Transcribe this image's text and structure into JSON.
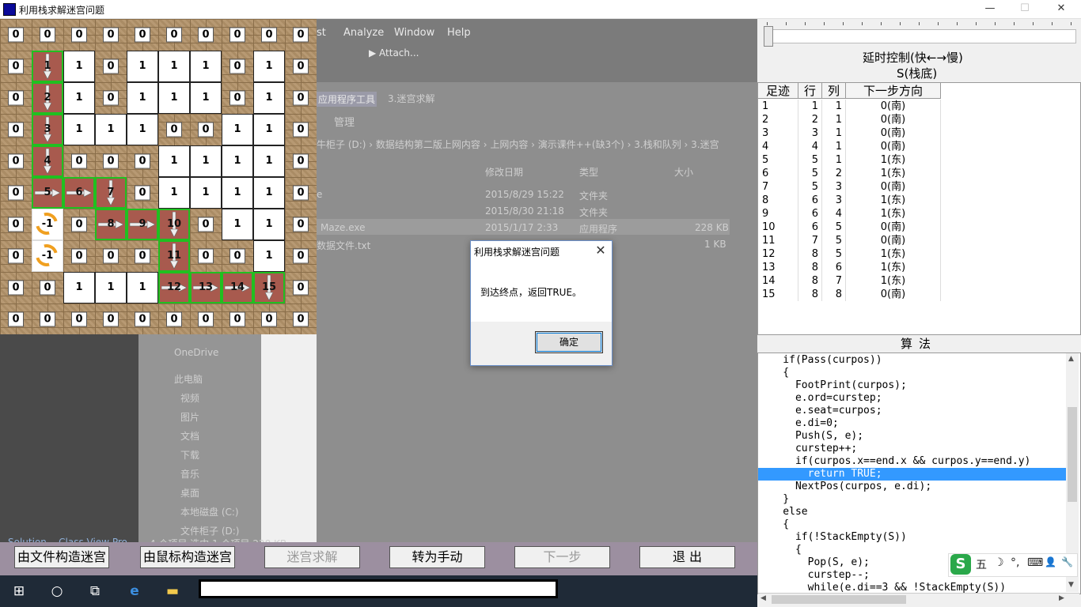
{
  "window": {
    "title": "利用栈求解迷宫问题",
    "min": "—",
    "max": "☐",
    "close": "✕"
  },
  "maze": {
    "grid": [
      [
        "0",
        "0",
        "0",
        "0",
        "0",
        "0",
        "0",
        "0",
        "0",
        "0"
      ],
      [
        "0",
        "S",
        "1",
        "0",
        "1",
        "1",
        "1",
        "0",
        "1",
        "0"
      ],
      [
        "0",
        "S",
        "1",
        "0",
        "1",
        "1",
        "1",
        "0",
        "1",
        "0"
      ],
      [
        "0",
        "S",
        "1",
        "1",
        "1",
        "0",
        "0",
        "1",
        "1",
        "0"
      ],
      [
        "0",
        "S",
        "0",
        "0",
        "0",
        "1",
        "1",
        "1",
        "1",
        "0"
      ],
      [
        "0",
        "E",
        "E",
        "S",
        "0",
        "1",
        "1",
        "1",
        "1",
        "0"
      ],
      [
        "0",
        "X",
        "0",
        "E",
        "E",
        "S",
        "0",
        "1",
        "1",
        "0"
      ],
      [
        "0",
        "X",
        "0",
        "0",
        "0",
        "S",
        "0",
        "0",
        "1",
        "0"
      ],
      [
        "0",
        "0",
        "1",
        "1",
        "1",
        "E",
        "E",
        "E",
        "S",
        "0"
      ],
      [
        "0",
        "0",
        "0",
        "0",
        "0",
        "0",
        "0",
        "0",
        "0",
        "0"
      ]
    ],
    "path_labels": {
      "1-1": "1",
      "2-1": "2",
      "3-1": "3",
      "4-1": "4",
      "5-1": "5",
      "5-2": "6",
      "5-3": "7",
      "6-3": "8",
      "6-4": "9",
      "6-5": "10",
      "7-5": "11",
      "8-5": "12",
      "8-6": "13",
      "8-7": "14",
      "8-8": "15"
    },
    "dead_label": "-1"
  },
  "background": {
    "menu": [
      "st",
      "Analyze",
      "Window",
      "Help"
    ],
    "attach": "▶ Attach...",
    "ribbon_tool": "应用程序工具",
    "ribbon_tab": "3.迷宫求解",
    "manage": "管理",
    "breadcrumb": "牛柜子 (D:)  ›  数据结构第二版上网内容  ›  上网内容  ›  演示课件++(缺3个)  ›  3.栈和队列  ›  3.迷宫",
    "col_date": "修改日期",
    "col_type": "类型",
    "col_size": "大小",
    "files": [
      {
        "name": "e",
        "date": "2015/8/29 15:22",
        "type": "文件夹",
        "size": ""
      },
      {
        "name": "",
        "date": "2015/8/30 21:18",
        "type": "文件夹",
        "size": ""
      },
      {
        "name": "Maze.exe",
        "date": "2015/1/17 2:33",
        "type": "应用程序",
        "size": "228 KB"
      },
      {
        "name": "数据文件.txt",
        "date": "",
        "type": "",
        "size": "1 KB"
      }
    ],
    "nav": [
      "OneDrive",
      "此电脑",
      "视频",
      "图片",
      "文档",
      "下载",
      "音乐",
      "桌面",
      "本地磁盘 (C:)",
      "文件柜子 (D:)"
    ],
    "status": "4 个项目    选中 1 个项目  228 KB",
    "vs_tabs": "Solution...   Class View   Pro"
  },
  "dialog": {
    "title": "利用栈求解迷宫问题",
    "message": "到达终点，返回TRUE。",
    "ok": "确定"
  },
  "right": {
    "delay_label": "延时控制(快←→慢)",
    "stack_title": "S(栈底)",
    "headers": [
      "足迹",
      "行",
      "列",
      "下一步方向"
    ],
    "rows": [
      [
        "1",
        "1",
        "1",
        "0(南)"
      ],
      [
        "2",
        "2",
        "1",
        "0(南)"
      ],
      [
        "3",
        "3",
        "1",
        "0(南)"
      ],
      [
        "4",
        "4",
        "1",
        "0(南)"
      ],
      [
        "5",
        "5",
        "1",
        "1(东)"
      ],
      [
        "6",
        "5",
        "2",
        "1(东)"
      ],
      [
        "7",
        "5",
        "3",
        "0(南)"
      ],
      [
        "8",
        "6",
        "3",
        "1(东)"
      ],
      [
        "9",
        "6",
        "4",
        "1(东)"
      ],
      [
        "10",
        "6",
        "5",
        "0(南)"
      ],
      [
        "11",
        "7",
        "5",
        "0(南)"
      ],
      [
        "12",
        "8",
        "5",
        "1(东)"
      ],
      [
        "13",
        "8",
        "6",
        "1(东)"
      ],
      [
        "14",
        "8",
        "7",
        "1(东)"
      ],
      [
        "15",
        "8",
        "8",
        "0(南)"
      ]
    ],
    "algo_title": "算法",
    "code": [
      "    if(Pass(curpos))",
      "    {",
      "      FootPrint(curpos);",
      "      e.ord=curstep;",
      "      e.seat=curpos;",
      "      e.di=0;",
      "      Push(S, e);",
      "      curstep++;",
      "      if(curpos.x==end.x && curpos.y==end.y)",
      "        return TRUE;",
      "      NextPos(curpos, e.di);",
      "    }",
      "    else",
      "    {",
      "      if(!StackEmpty(S))",
      "      {",
      "        Pop(S, e);",
      "        curstep--;",
      "        while(e.di==3 && !StackEmpty(S))"
    ],
    "highlight_line": 9
  },
  "buttons": {
    "from_file": "由文件构造迷宫",
    "from_mouse": "由鼠标构造迷宫",
    "solve": "迷宫求解",
    "manual": "转为手动",
    "next": "下一步",
    "exit": "退  出"
  },
  "ime": {
    "logo": "S",
    "items": [
      "五",
      "☽",
      "°,",
      "⌨",
      "👤",
      "🔧"
    ]
  },
  "colors": {
    "highlight": "#3399ff",
    "path_fill": "#a85a4e",
    "path_border": "#20c020",
    "dialog_border": "#6a8fc8"
  }
}
